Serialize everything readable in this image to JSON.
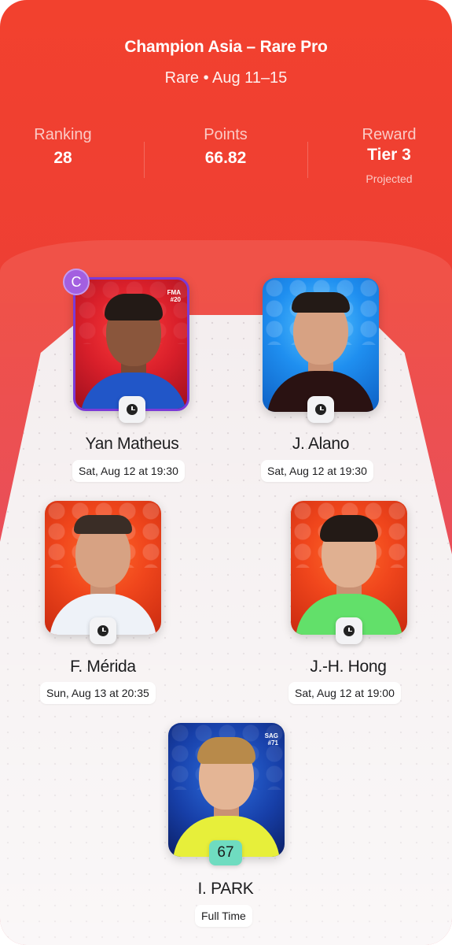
{
  "header": {
    "title": "Champion Asia – Rare Pro",
    "subtitle": "Rare • Aug 11–15"
  },
  "stats": [
    {
      "label": "Ranking",
      "value": "28",
      "note": ""
    },
    {
      "label": "Points",
      "value": "66.82",
      "note": ""
    },
    {
      "label": "Reward",
      "value": "Tier 3",
      "note": "Projected"
    }
  ],
  "players": [
    {
      "name": "Yan Matheus",
      "kickoff": "Sat, Aug 12 at 19:30",
      "status_icon": "clock-icon",
      "card_code_line1": "FMA",
      "card_code_line2": "#20",
      "captain": "C"
    },
    {
      "name": "J. Alano",
      "kickoff": "Sat, Aug 12 at 19:30",
      "status_icon": "clock-icon"
    },
    {
      "name": "F. Mérida",
      "kickoff": "Sun, Aug 13 at 20:35",
      "status_icon": "clock-icon"
    },
    {
      "name": "J.-H. Hong",
      "kickoff": "Sat, Aug 12 at 19:00",
      "status_icon": "clock-icon"
    },
    {
      "name": "I. PARK",
      "kickoff": "Full Time",
      "score": "67",
      "card_code_line1": "SAG",
      "card_code_line2": "#71"
    }
  ],
  "colors": {
    "header_red": "#f2412e",
    "captain_purple": "#a35fe0",
    "score_teal": "#6fdcc0"
  }
}
